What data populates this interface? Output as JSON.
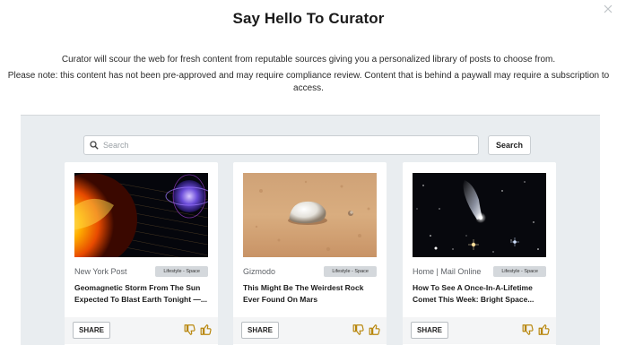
{
  "modal": {
    "title": "Say Hello To Curator",
    "intro_line1": "Curator will scour the web for fresh content from reputable sources giving you a personalized library of posts to choose from.",
    "intro_line2": "Please note: this content has not been pre-approved and may require compliance review. Content that is behind a paywall may require a subscription to access.",
    "close_icon": "close-icon"
  },
  "search": {
    "placeholder": "Search",
    "value": "",
    "button_label": "Search",
    "icon": "search-icon"
  },
  "cards": [
    {
      "source": "New York Post",
      "tag": "Lifestyle - Space",
      "headline": "Geomagnetic Storm From The Sun Expected To Blast Earth Tonight —...",
      "image": "solar-storm-image",
      "share_label": "SHARE"
    },
    {
      "source": "Gizmodo",
      "tag": "Lifestyle - Space",
      "headline": "This Might Be The Weirdest Rock Ever Found On Mars",
      "image": "mars-rock-image",
      "share_label": "SHARE"
    },
    {
      "source": "Home | Mail Online",
      "tag": "Lifestyle - Space",
      "headline": "How To See A Once-In-A-Lifetime Comet This Week: Bright Space...",
      "image": "comet-image",
      "share_label": "SHARE"
    }
  ],
  "colors": {
    "panel_bg": "#e9edf0",
    "accent_thumb": "#b8860b",
    "tag_bg": "#d4d8dc"
  }
}
